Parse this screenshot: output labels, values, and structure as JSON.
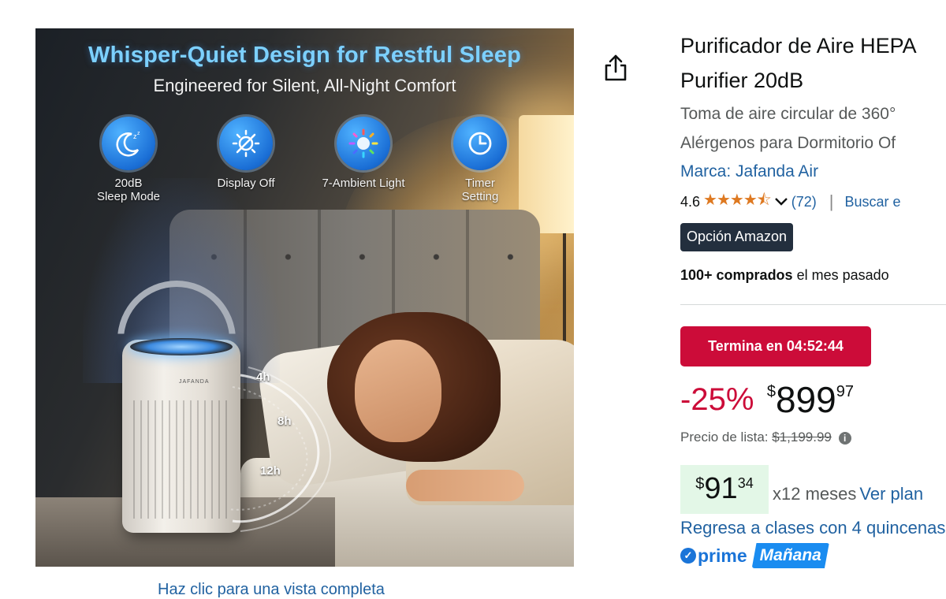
{
  "image": {
    "headline": "Whisper-Quiet Design for Restful Sleep",
    "subheadline": "Engineered for Silent, All-Night Comfort",
    "features": [
      {
        "icon": "moon-sleep-icon",
        "label_line1": "20dB",
        "label_line2": "Sleep Mode"
      },
      {
        "icon": "display-off-icon",
        "label_line1": "Display Off",
        "label_line2": ""
      },
      {
        "icon": "ambient-light-icon",
        "label_line1": "7-Ambient Light",
        "label_line2": ""
      },
      {
        "icon": "clock-icon",
        "label_line1": "Timer",
        "label_line2": "Setting"
      }
    ],
    "timer_labels": [
      "4h",
      "8h",
      "12h"
    ],
    "device_brand": "JAFANDA"
  },
  "full_view_link": "Haz clic para una vista completa",
  "share": {
    "icon": "share-icon"
  },
  "product": {
    "title_line1": "Purificador de Aire HEPA",
    "title_line2": "Purifier 20dB",
    "subtitle_line1": "Toma de aire circular de 360°",
    "subtitle_line2": "Alérgenos para Dormitorio Of",
    "brand": "Marca: Jafanda Air",
    "rating_value": "4.6",
    "stars": "★★★★⯪",
    "rating_count": "(72)",
    "separator": "|",
    "search_link": "Buscar e",
    "choice_badge": "Opción Amazon",
    "bought_bold": "100+ comprados",
    "bought_rest": " el mes pasado"
  },
  "deal": {
    "label": "Termina en 04:52:44"
  },
  "price": {
    "discount": "-25%",
    "symbol": "$",
    "whole": "899",
    "fraction": "97",
    "list_label": "Precio de lista:",
    "list_value": "$1,199.99"
  },
  "installments": {
    "symbol": "$",
    "whole": "91",
    "fraction": "34",
    "months": "x12 meses",
    "plan_link": "Ver plan"
  },
  "promo": "Regresa a clases con 4 quincenas",
  "prime": {
    "check": "✓",
    "label": "prime",
    "delivery": "Mañana"
  },
  "colors": {
    "deal_red": "#cc0c39",
    "link_blue": "#2162a1",
    "star_orange": "#de7921",
    "badge_dark": "#232f3e",
    "prime_blue": "#1a74d8",
    "installment_green": "#e3f7e7"
  }
}
